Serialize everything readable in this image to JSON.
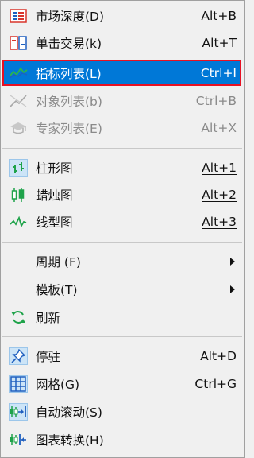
{
  "menu": {
    "items": [
      {
        "label": "市场深度(D)",
        "shortcut": "Alt+B",
        "icon": "market-depth-icon"
      },
      {
        "label": "单击交易(k)",
        "shortcut": "Alt+T",
        "icon": "one-click-trade-icon"
      },
      {
        "label": "指标列表(L)",
        "shortcut": "Ctrl+I",
        "icon": "indicator-list-icon",
        "selected": true
      },
      {
        "label": "对象列表(b)",
        "shortcut": "Ctrl+B",
        "icon": "object-list-icon",
        "disabled": true
      },
      {
        "label": "专家列表(E)",
        "shortcut": "Alt+X",
        "icon": "expert-list-icon",
        "disabled": true
      },
      {
        "label": "柱形图",
        "shortcut": "Alt+1",
        "icon": "bar-chart-icon",
        "checked": true
      },
      {
        "label": "蜡烛图",
        "shortcut": "Alt+2",
        "icon": "candlestick-icon"
      },
      {
        "label": "线型图",
        "shortcut": "Alt+3",
        "icon": "line-chart-icon"
      },
      {
        "label": "周期 (F)",
        "shortcut": "",
        "icon": "",
        "submenu": true
      },
      {
        "label": "模板(T)",
        "shortcut": "",
        "icon": "",
        "submenu": true
      },
      {
        "label": "刷新",
        "shortcut": "",
        "icon": "refresh-icon"
      },
      {
        "label": "停驻",
        "shortcut": "Alt+D",
        "icon": "pin-icon",
        "checked": true
      },
      {
        "label": "网格(G)",
        "shortcut": "Ctrl+G",
        "icon": "grid-icon",
        "checked": true
      },
      {
        "label": "自动滚动(S)",
        "shortcut": "",
        "icon": "auto-scroll-icon",
        "checked": true
      },
      {
        "label": "图表转换(H)",
        "shortcut": "",
        "icon": "chart-shift-icon"
      }
    ]
  },
  "colors": {
    "selected_bg": "#0078d7",
    "highlight_border": "#e81123",
    "check_bg": "#cce4f7",
    "icon_green": "#1fa34a",
    "icon_blue": "#1f5fbf",
    "icon_red": "#d9342b"
  }
}
